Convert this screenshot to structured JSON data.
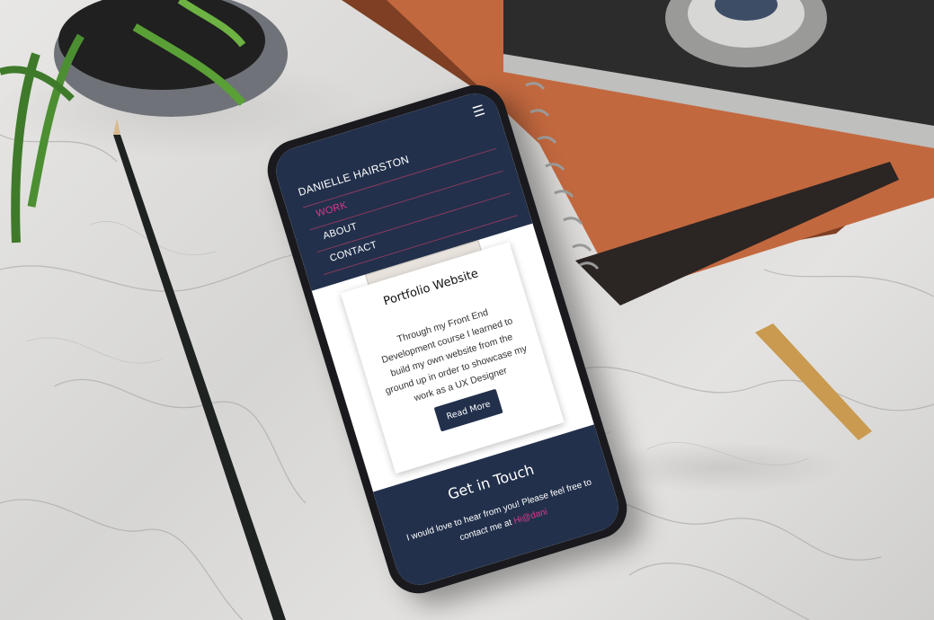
{
  "site": {
    "brand": "DANIELLE HAIRSTON",
    "menu_icon": "hamburger-menu-icon",
    "nav": [
      {
        "label": "WORK",
        "active": true
      },
      {
        "label": "ABOUT",
        "active": false
      },
      {
        "label": "CONTACT",
        "active": false
      }
    ],
    "card": {
      "title": "Portfolio Website",
      "text": "Through my Front End Development course I learned to build my own website from the ground up in order to showcase my work as a UX Designer",
      "button": "Read More"
    },
    "footer": {
      "title": "Get in Touch",
      "text": "I would love to hear from you! Please feel free to contact me at",
      "link": "Hi@dani"
    }
  },
  "colors": {
    "navy": "#22304b",
    "accent_pink": "#e0388a",
    "notebook_orange": "#c2683f"
  }
}
